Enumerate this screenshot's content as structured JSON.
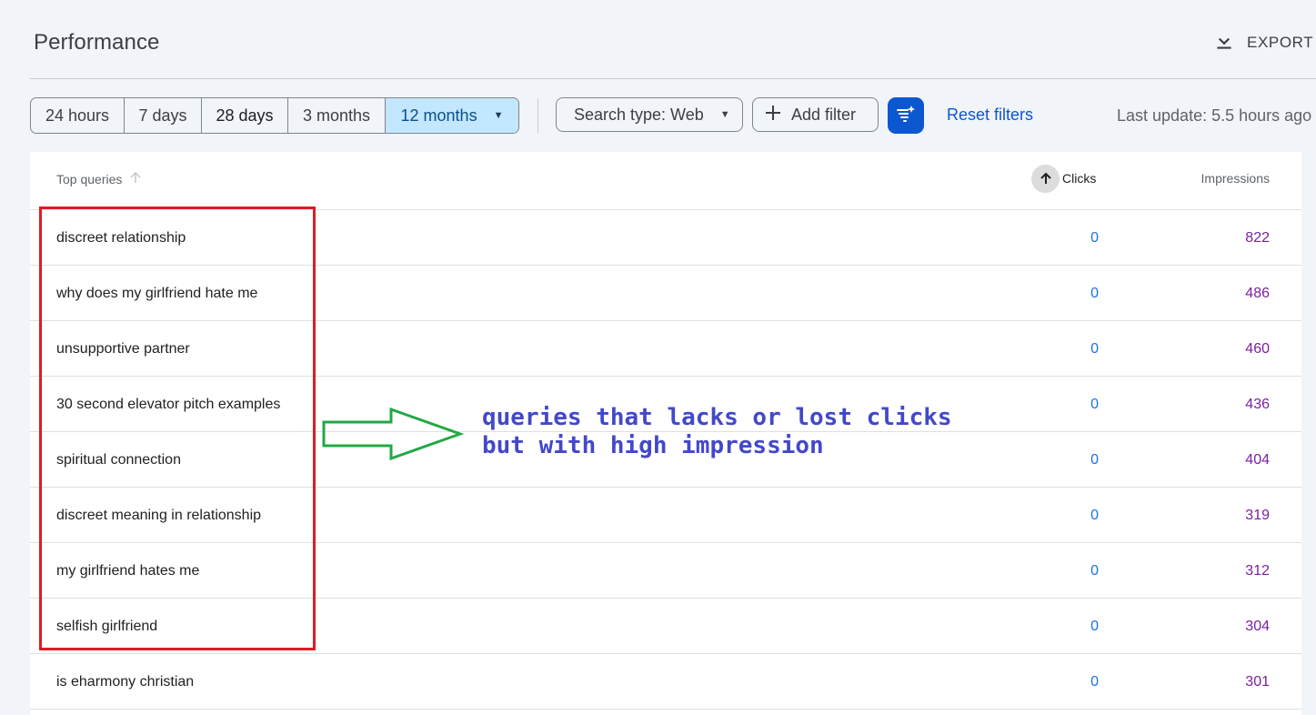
{
  "header": {
    "title": "Performance",
    "export_label": "EXPORT"
  },
  "toolbar": {
    "ranges": [
      {
        "label": "24 hours"
      },
      {
        "label": "7 days"
      },
      {
        "label": "28 days"
      },
      {
        "label": "3 months"
      },
      {
        "label": "12 months"
      }
    ],
    "selected_range": "12 months",
    "search_type_label": "Search type: Web",
    "add_filter_label": "Add filter",
    "reset_filters_label": "Reset filters",
    "last_update": "Last update: 5.5 hours ago"
  },
  "table": {
    "columns": {
      "queries": "Top queries",
      "clicks": "Clicks",
      "impressions": "Impressions"
    },
    "rows": [
      {
        "query": "discreet relationship",
        "clicks": "0",
        "impressions": "822"
      },
      {
        "query": "why does my girlfriend hate me",
        "clicks": "0",
        "impressions": "486"
      },
      {
        "query": "unsupportive partner",
        "clicks": "0",
        "impressions": "460"
      },
      {
        "query": "30 second elevator pitch examples",
        "clicks": "0",
        "impressions": "436"
      },
      {
        "query": "spiritual connection",
        "clicks": "0",
        "impressions": "404"
      },
      {
        "query": "discreet meaning in relationship",
        "clicks": "0",
        "impressions": "319"
      },
      {
        "query": "my girlfriend hates me",
        "clicks": "0",
        "impressions": "312"
      },
      {
        "query": "selfish girlfriend",
        "clicks": "0",
        "impressions": "304"
      },
      {
        "query": "is eharmony christian",
        "clicks": "0",
        "impressions": "301"
      }
    ]
  },
  "annotation": {
    "line1": "queries that lacks or lost clicks",
    "line2": "but with high impression"
  },
  "colors": {
    "accent": "#0b57d0",
    "selected_range_bg": "#c2e7ff",
    "clicks": "#1a73e8",
    "impressions": "#7b1fa2",
    "annotation_box": "#e01b24",
    "annotation_arrow": "#22a845",
    "annotation_text": "#4348c9"
  },
  "icons": {
    "export": "download-icon",
    "dropdown": "caret-down-icon",
    "add": "plus-icon",
    "filter": "filter-sparkle-icon",
    "sort": "arrow-up-icon"
  }
}
